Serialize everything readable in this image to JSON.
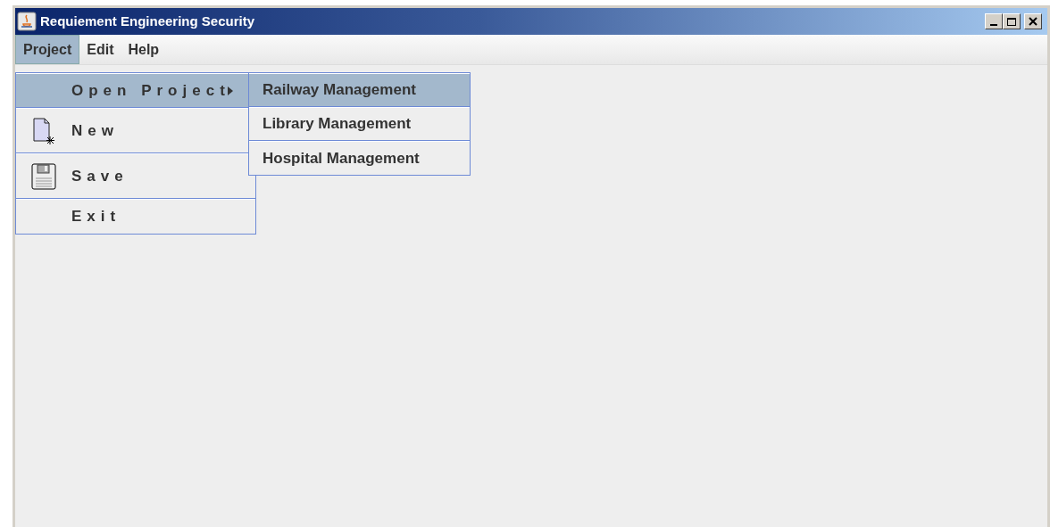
{
  "window": {
    "title": "Requiement Engineering Security"
  },
  "menu_bar": [
    {
      "label": "Project",
      "selected": true
    },
    {
      "label": "Edit",
      "selected": false
    },
    {
      "label": "Help",
      "selected": false
    }
  ],
  "menu": {
    "items": [
      {
        "label": "Open Project",
        "kind": "submenu",
        "selected": true
      },
      {
        "label": "New",
        "kind": "new",
        "selected": false
      },
      {
        "label": "Save",
        "kind": "save",
        "selected": false
      },
      {
        "label": "Exit",
        "kind": "plain",
        "selected": false
      }
    ]
  },
  "submenu": {
    "items": [
      {
        "label": "Railway Management",
        "selected": true
      },
      {
        "label": "Library Management",
        "selected": false
      },
      {
        "label": "Hospital Management",
        "selected": false
      }
    ]
  }
}
